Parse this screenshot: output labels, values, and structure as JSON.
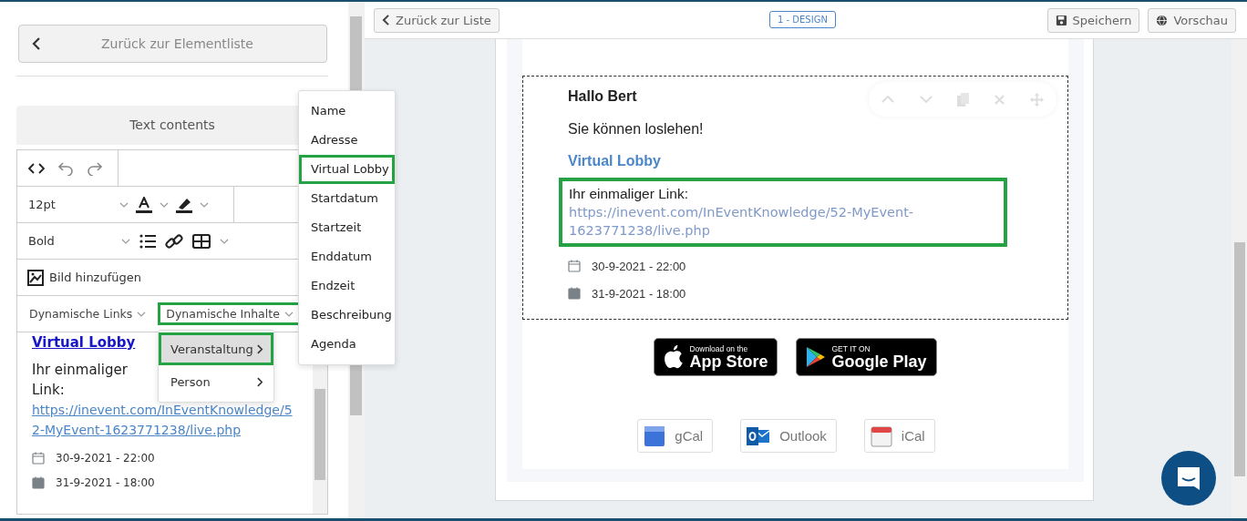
{
  "left_panel": {
    "back_button": "Zurück zur Elementliste",
    "section_title": "Text contents",
    "toolbar": {
      "font_size": "12pt",
      "font_weight": "Bold",
      "image_button": "Bild hinzufügen",
      "dropdowns": [
        {
          "label": "Dynamische Links",
          "highlighted": false
        },
        {
          "label": "Dynamische Inhalte",
          "highlighted": true
        }
      ]
    },
    "editor_content": {
      "heading": "Virtual Lobby",
      "link_prefix": "Ihr einmaliger Link:",
      "link_url": "https://inevent.com/InEventKnowledge/52-MyEvent-1623771238/live.php",
      "dates": [
        {
          "text": "30-9-2021 - 22:00",
          "kind": "start"
        },
        {
          "text": "31-9-2021 - 18:00",
          "kind": "end"
        }
      ]
    },
    "submenu": [
      {
        "label": "Veranstaltung",
        "selected": true,
        "highlighted": true
      },
      {
        "label": "Person",
        "selected": false,
        "highlighted": false
      }
    ],
    "flyout_menu": [
      {
        "label": "Name",
        "highlighted": false
      },
      {
        "label": "Adresse",
        "highlighted": false
      },
      {
        "label": "Virtual Lobby",
        "highlighted": true
      },
      {
        "label": "Startdatum",
        "highlighted": false
      },
      {
        "label": "Startzeit",
        "highlighted": false
      },
      {
        "label": "Enddatum",
        "highlighted": false
      },
      {
        "label": "Endzeit",
        "highlighted": false
      },
      {
        "label": "Beschreibung",
        "highlighted": false
      },
      {
        "label": "Agenda",
        "highlighted": false
      }
    ]
  },
  "top_bar": {
    "back_button": "Zurück zur Liste",
    "step_badge": "1 - DESIGN",
    "save_button": "Speichern",
    "preview_button": "Vorschau"
  },
  "email": {
    "greeting": "Hallo Bert",
    "message": "Sie können loslehen!",
    "heading": "Virtual Lobby",
    "link_prefix": "Ihr einmaliger Link:",
    "link_url": "https://inevent.com/InEventKnowledge/52-MyEvent-1623771238/live.php",
    "link_highlighted": true,
    "dates": [
      {
        "text": "30-9-2021 - 22:00",
        "kind": "start"
      },
      {
        "text": "31-9-2021 - 18:00",
        "kind": "end"
      }
    ],
    "store_badges": [
      {
        "kind": "apple",
        "small": "Download on the",
        "big": "App Store"
      },
      {
        "kind": "google",
        "small": "GET IT ON",
        "big": "Google Play"
      }
    ],
    "calendar_buttons": [
      {
        "kind": "google",
        "label": "gCal"
      },
      {
        "kind": "outlook",
        "label": "Outlook"
      },
      {
        "kind": "apple",
        "label": "iCal"
      }
    ]
  }
}
